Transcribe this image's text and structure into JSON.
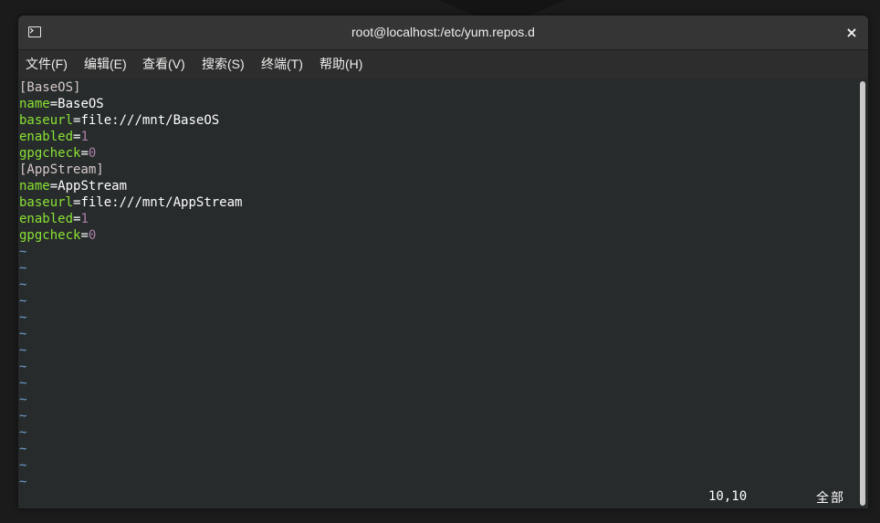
{
  "window": {
    "title": "root@localhost:/etc/yum.repos.d",
    "close_glyph": "×"
  },
  "menu": {
    "items": [
      "文件(F)",
      "编辑(E)",
      "查看(V)",
      "搜索(S)",
      "终端(T)",
      "帮助(H)"
    ]
  },
  "file": {
    "lines": [
      {
        "type": "section",
        "text": "[BaseOS]"
      },
      {
        "type": "kv",
        "key": "name",
        "value": "BaseOS"
      },
      {
        "type": "kv",
        "key": "baseurl",
        "value": "file:///mnt/BaseOS"
      },
      {
        "type": "kvnum",
        "key": "enabled",
        "value": "1"
      },
      {
        "type": "kvnum",
        "key": "gpgcheck",
        "value": "0"
      },
      {
        "type": "section",
        "text": "[AppStream]"
      },
      {
        "type": "kv",
        "key": "name",
        "value": "AppStream"
      },
      {
        "type": "kv",
        "key": "baseurl",
        "value": "file:///mnt/AppStream"
      },
      {
        "type": "kvnum",
        "key": "enabled",
        "value": "1"
      },
      {
        "type": "kvnum",
        "key": "gpgcheck",
        "value": "0"
      }
    ],
    "empty_line_marker": "~",
    "empty_line_count": 15
  },
  "status": {
    "position": "10,10",
    "scope": "全部"
  },
  "colors": {
    "key": "#8ae234",
    "number": "#ad7fa8",
    "tilde": "#729fcf",
    "section": "#d8c9c9",
    "background": "#272b2c"
  }
}
